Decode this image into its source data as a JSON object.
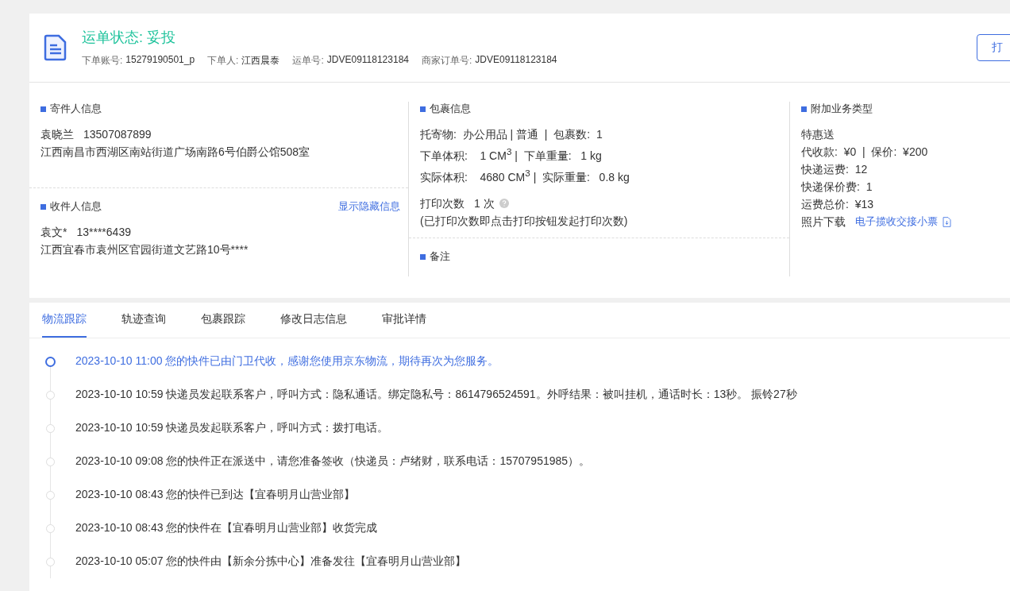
{
  "header": {
    "status": "运单状态: 妥投",
    "meta": [
      {
        "label": "下单账号:",
        "value": "15279190501_p"
      },
      {
        "label": "下单人:",
        "value": "江西晨泰"
      },
      {
        "label": "运单号:",
        "value": "JDVE09118123184"
      },
      {
        "label": "商家订单号:",
        "value": "JDVE09118123184"
      }
    ],
    "print_button": "打"
  },
  "sender": {
    "title": "寄件人信息",
    "name": "袁晓兰",
    "phone": "13507087899",
    "address": "江西南昌市西湖区南站街道广场南路6号伯爵公馆508室"
  },
  "receiver": {
    "title": "收件人信息",
    "link": "显示隐藏信息",
    "name": "袁文*",
    "phone": "13****6439",
    "address": "江西宜春市袁州区官园街道文艺路10号****"
  },
  "package": {
    "title": "包裹信息",
    "lines": [
      "托寄物:  办公用品 | 普通  |  包裹数:  1",
      "下单体积:    1 CM$^{3}$ |  下单重量:   1 kg",
      "实际体积:    4680 CM$^{3}$ |  实际重量:   0.8 kg"
    ],
    "print_count_label": "打印次数",
    "print_count": "1 次",
    "print_note": "(已打印次数即点击打印按钮发起打印次数)"
  },
  "remark": {
    "title": "备注"
  },
  "extra": {
    "title": "附加业务类型",
    "lines": [
      "特惠送",
      "代收款:  ¥0  |  保价:  ¥200",
      "快递运费:  12",
      "快递保价费:  1",
      "运费总价:  ¥13"
    ],
    "photo_label": "照片下载",
    "photo_link": "电子揽收交接小票"
  },
  "tabs": [
    {
      "label": "物流跟踪",
      "selected": true
    },
    {
      "label": "轨迹查询",
      "selected": false
    },
    {
      "label": "包裹跟踪",
      "selected": false
    },
    {
      "label": "修改日志信息",
      "selected": false
    },
    {
      "label": "审批详情",
      "selected": false
    }
  ],
  "events": [
    {
      "text": "2023-10-10 11:00 您的快件已由门卫代收，感谢您使用京东物流，期待再次为您服务。",
      "current": true
    },
    {
      "text": "2023-10-10 10:59 快递员发起联系客户，呼叫方式：隐私通话。绑定隐私号：8614796524591。外呼结果：被叫挂机，通话时长：13秒。 振铃27秒",
      "current": false
    },
    {
      "text": "2023-10-10 10:59 快递员发起联系客户，呼叫方式：拨打电话。",
      "current": false
    },
    {
      "text": "2023-10-10 09:08 您的快件正在派送中，请您准备签收（快递员：卢绪财，联系电话：15707951985）。",
      "current": false
    },
    {
      "text": "2023-10-10 08:43 您的快件已到达【宜春明月山营业部】",
      "current": false
    },
    {
      "text": "2023-10-10 08:43 您的快件在【宜春明月山营业部】收货完成",
      "current": false
    },
    {
      "text": "2023-10-10 05:07 您的快件由【新余分拣中心】准备发往【宜春明月山营业部】",
      "current": false
    }
  ]
}
